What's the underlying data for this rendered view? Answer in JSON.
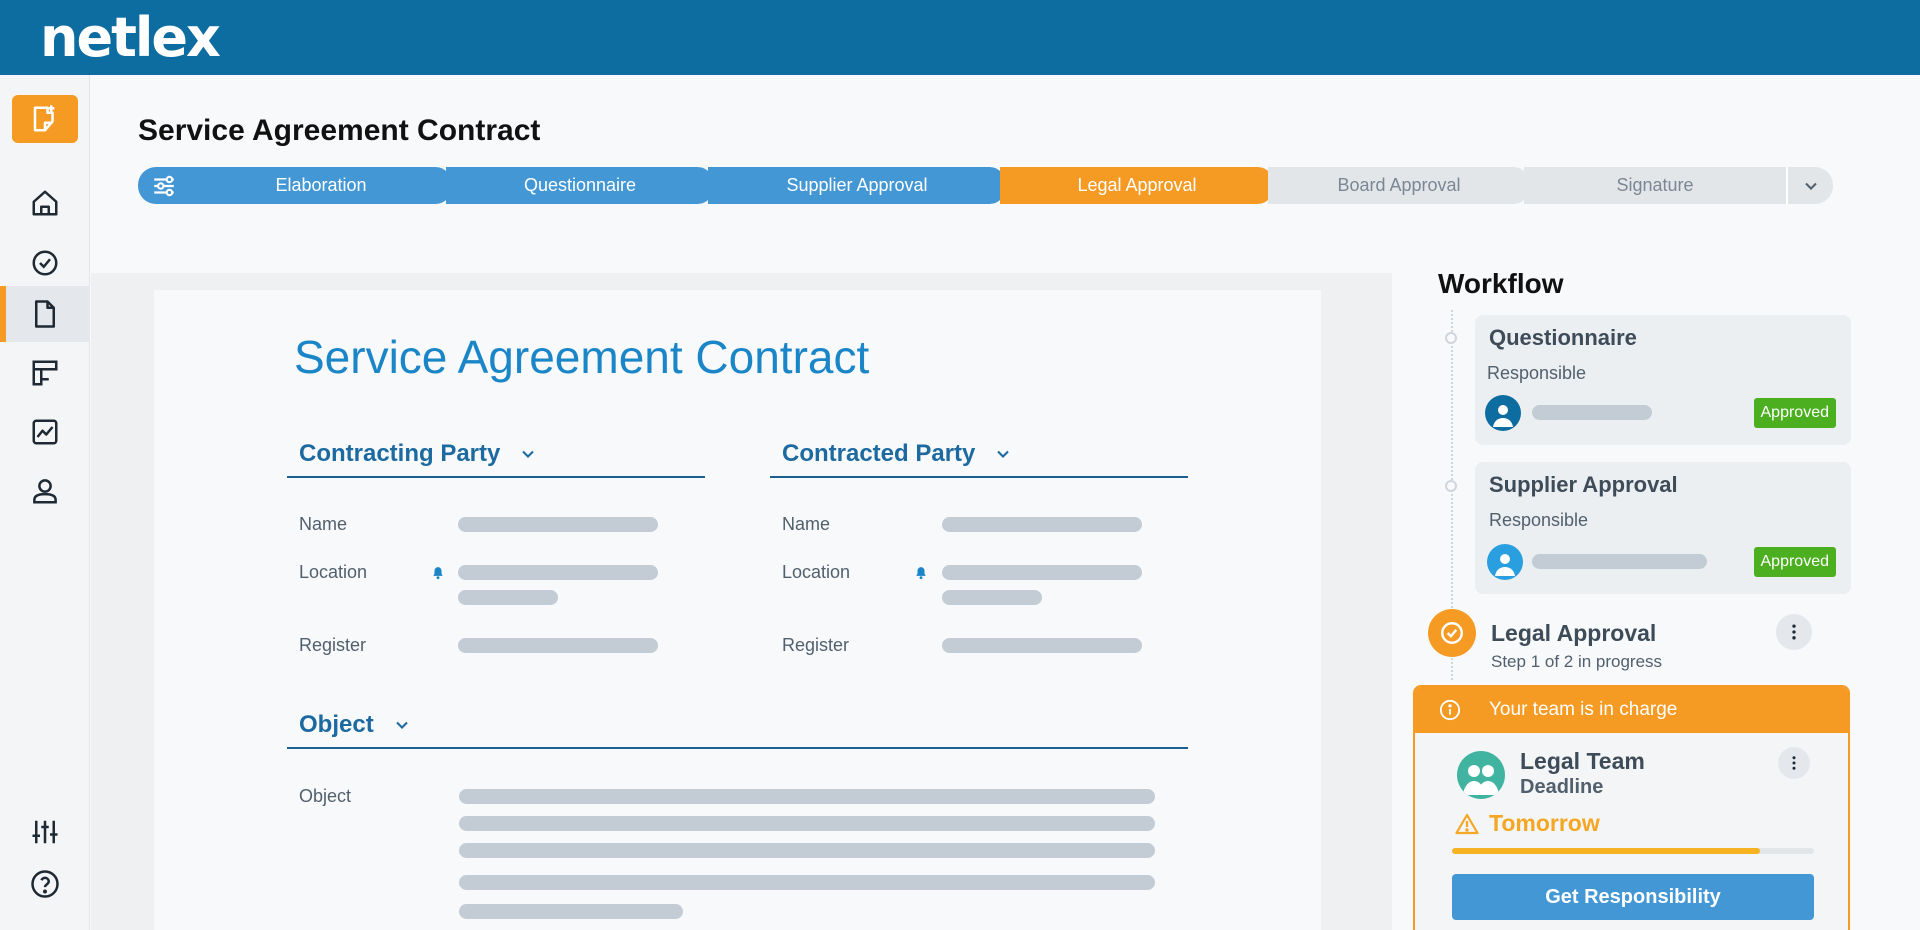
{
  "app": {
    "logo_text": "netlex"
  },
  "sidebar": {
    "items": [
      {
        "name": "new-document",
        "icon": "new-document-icon"
      },
      {
        "name": "home",
        "icon": "home-icon"
      },
      {
        "name": "tasks",
        "icon": "check-circle-icon"
      },
      {
        "name": "documents",
        "icon": "document-icon",
        "active": true
      },
      {
        "name": "boards",
        "icon": "board-icon"
      },
      {
        "name": "analytics",
        "icon": "chart-icon"
      },
      {
        "name": "profile",
        "icon": "user-icon"
      },
      {
        "name": "settings",
        "icon": "sliders-icon"
      },
      {
        "name": "help",
        "icon": "help-icon"
      }
    ]
  },
  "page": {
    "title": "Service Agreement Contract"
  },
  "stepper": {
    "steps": [
      {
        "label": "Elaboration",
        "state": "done"
      },
      {
        "label": "Questionnaire",
        "state": "done"
      },
      {
        "label": "Supplier Approval",
        "state": "done"
      },
      {
        "label": "Legal Approval",
        "state": "current"
      },
      {
        "label": "Board Approval",
        "state": "todo"
      },
      {
        "label": "Signature",
        "state": "todo"
      }
    ]
  },
  "document": {
    "title": "Service Agreement Contract",
    "contracting_party": {
      "heading": "Contracting Party",
      "fields": {
        "name": "Name",
        "location": "Location",
        "register": "Register"
      }
    },
    "contracted_party": {
      "heading": "Contracted Party",
      "fields": {
        "name": "Name",
        "location": "Location",
        "register": "Register"
      }
    },
    "object": {
      "heading": "Object",
      "label": "Object"
    }
  },
  "workflow": {
    "title": "Workflow",
    "questionnaire": {
      "title": "Questionnaire",
      "responsible_label": "Responsible",
      "status": "Approved"
    },
    "supplier_approval": {
      "title": "Supplier Approval",
      "responsible_label": "Responsible",
      "status": "Approved"
    },
    "legal_approval": {
      "title": "Legal  Approval",
      "subtitle": "Step 1 of 2 in progress",
      "charge_notice": "Your team is in charge",
      "team_name": "Legal Team",
      "deadline_label": "Deadline",
      "deadline_value": "Tomorrow",
      "deadline_progress": 0.85,
      "button_label": "Get Responsibility"
    }
  },
  "colors": {
    "brand": "#0e6da0",
    "accent": "#f59a23",
    "step_done": "#4397d4",
    "approved": "#4caf1f",
    "warning": "#f5a623"
  }
}
